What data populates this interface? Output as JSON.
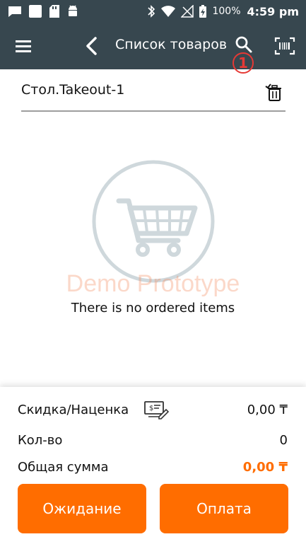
{
  "status_bar": {
    "battery": "100%",
    "time": "4:59 pm",
    "icons": [
      "message-icon",
      "square-icon",
      "sd-card-icon",
      "android-icon",
      "bluetooth-icon",
      "wifi-icon",
      "no-signal-icon",
      "battery-charging-icon"
    ]
  },
  "app_bar": {
    "title": "Список товаров",
    "menu_icon": "menu-icon",
    "back_icon": "back-icon",
    "search_icon": "search-icon",
    "scan_icon": "barcode-scan-icon",
    "annotation": "1"
  },
  "order": {
    "table_name": "Стол.Takeout-1",
    "trash_icon": "trash-icon"
  },
  "empty_state": {
    "icon": "shopping-cart-icon",
    "watermark": "Demo Prototype",
    "message": "There is no ordered items"
  },
  "summary": {
    "discount_label": "Скидка/Наценка",
    "discount_value": "0,00 ₸",
    "quantity_label": "Кол-во",
    "quantity_value": "0",
    "total_label": "Общая сумма",
    "total_value": "0,00 ₸"
  },
  "actions": {
    "wait_label": "Ожидание",
    "pay_label": "Оплата"
  },
  "colors": {
    "app_bar": "#37474f",
    "accent": "#ff6d00",
    "annotation": "#e53935"
  }
}
